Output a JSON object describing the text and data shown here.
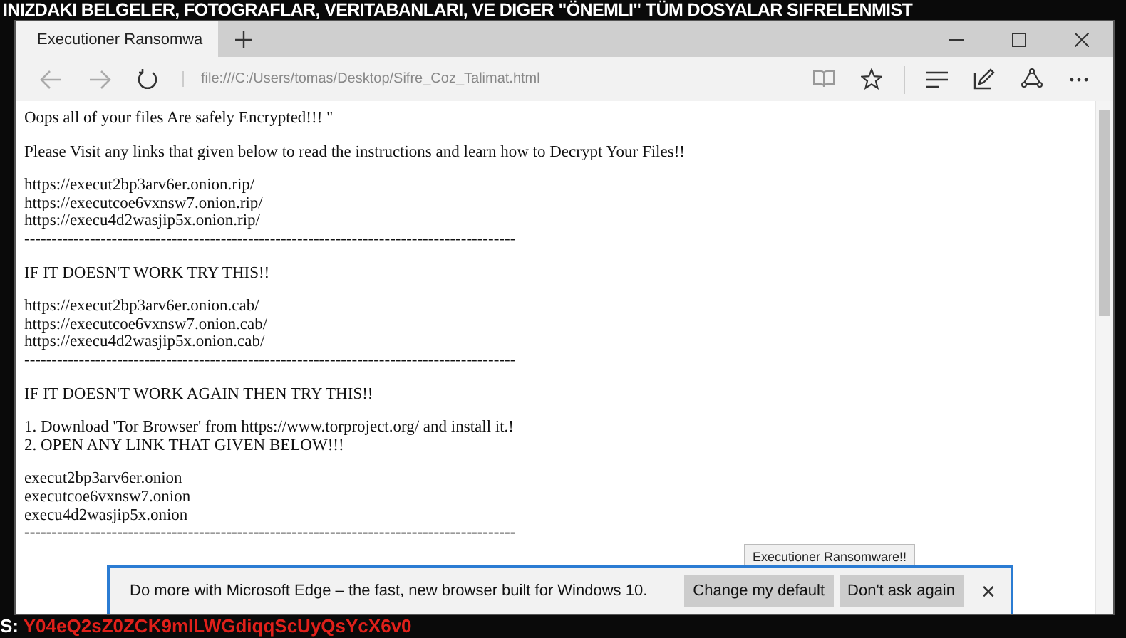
{
  "wallpaper": {
    "top_text": "INIZDAKI BELGELER, FOTOGRAFLAR, VERITABANLARI, VE DIGER \"ÖNEMLI\" TÜM DOSYALAR SIFRELENMIST",
    "bottom_label": "S:",
    "bottom_code": "Y04eQ2sZ0ZCK9mILWGdiqqScUyQsYcX6v0"
  },
  "window": {
    "tab_title": "Executioner Ransomwa",
    "url": "file:///C:/Users/tomas/Desktop/Sifre_Coz_Talimat.html"
  },
  "page": {
    "blocks": [
      {
        "lines": [
          "Oops all of your files Are safely Encrypted!!! \""
        ]
      },
      {
        "lines": [
          "Please Visit any links that given below to read the instructions and learn how to Decrypt Your Files!!"
        ]
      },
      {
        "lines": [
          "https://execut2bp3arv6er.onion.rip/",
          "https://executcoe6vxnsw7.onion.rip/",
          "https://execu4d2wasjip5x.onion.rip/",
          "------------------------------------------------------------------------------------------"
        ]
      },
      {
        "lines": [
          "IF IT DOESN'T WORK TRY THIS!!"
        ]
      },
      {
        "lines": [
          "https://execut2bp3arv6er.onion.cab/",
          "https://executcoe6vxnsw7.onion.cab/",
          "https://execu4d2wasjip5x.onion.cab/",
          "------------------------------------------------------------------------------------------"
        ]
      },
      {
        "lines": [
          "IF IT DOESN'T WORK AGAIN THEN TRY THIS!!"
        ]
      },
      {
        "lines": [
          "1. Download 'Tor Browser' from https://www.torproject.org/ and install it.!",
          "2. OPEN ANY LINK THAT GIVEN BELOW!!!"
        ]
      },
      {
        "lines": [
          "execut2bp3arv6er.onion",
          "executcoe6vxnsw7.onion",
          "execu4d2wasjip5x.onion",
          "------------------------------------------------------------------------------------------"
        ]
      }
    ],
    "button": "Executioner Ransomware!!"
  },
  "notification": {
    "message": "Do more with Microsoft Edge – the fast, new browser built for Windows 10.",
    "buttons": [
      "Change my default",
      "Don't ask again"
    ],
    "close": "✕"
  }
}
